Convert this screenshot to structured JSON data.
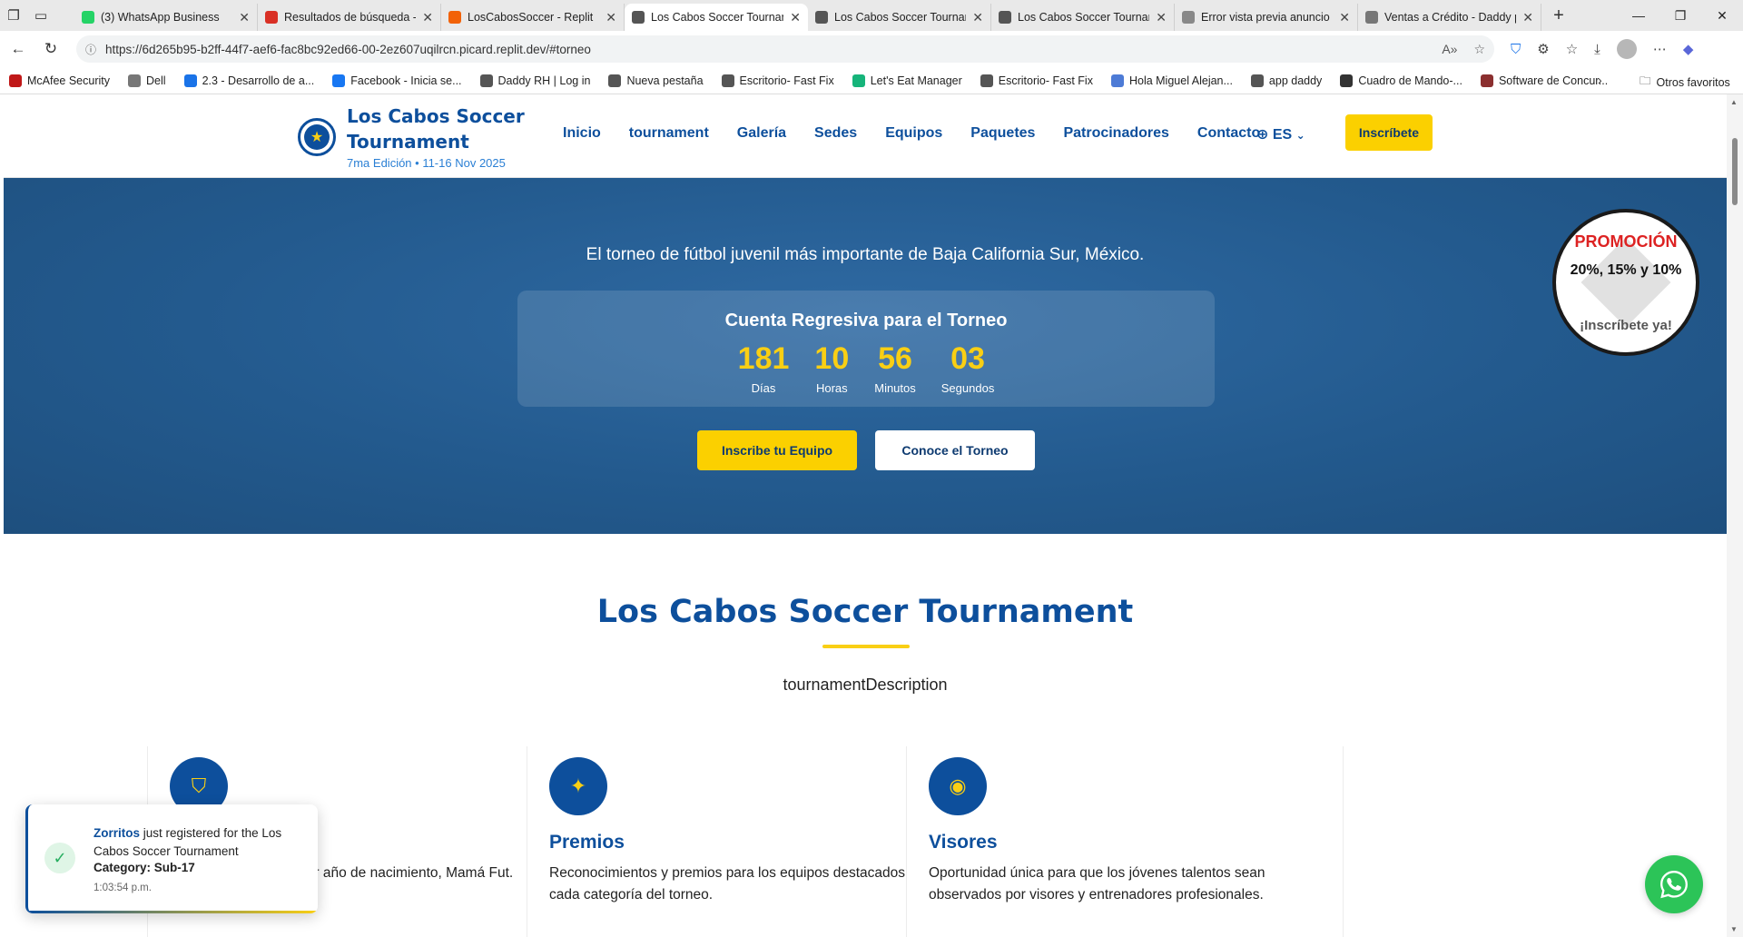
{
  "browser": {
    "tabs": [
      {
        "title": "(3) WhatsApp Business",
        "icon": "whatsapp-icon",
        "color": "#25d366"
      },
      {
        "title": "Resultados de búsqueda -",
        "icon": "gmail-icon",
        "color": "#d93025"
      },
      {
        "title": "LosCabosSoccer - Replit",
        "icon": "replit-icon",
        "color": "#f26207"
      },
      {
        "title": "Los Cabos Soccer Tournam",
        "icon": "globe-icon",
        "color": "#555555",
        "active": true
      },
      {
        "title": "Los Cabos Soccer Tournam",
        "icon": "globe-icon",
        "color": "#555555"
      },
      {
        "title": "Los Cabos Soccer Tournam",
        "icon": "globe-icon",
        "color": "#555555"
      },
      {
        "title": "Error vista previa anuncio",
        "icon": "circle-icon",
        "color": "#888888"
      },
      {
        "title": "Ventas a Crédito - Daddy p",
        "icon": "doc-icon",
        "color": "#777777"
      }
    ],
    "url": "https://6d265b95-b2ff-44f7-aef6-fac8bc92ed66-00-2ez607uqilrcn.picard.replit.dev/#torneo",
    "bookmarks": [
      {
        "label": "McAfee Security",
        "icon": "mcafee-icon",
        "color": "#c01818"
      },
      {
        "label": "Dell",
        "icon": "folder-icon",
        "color": "#777777"
      },
      {
        "label": "2.3 - Desarrollo de a...",
        "icon": "loading-icon",
        "color": "#1a73e8"
      },
      {
        "label": "Facebook - Inicia se...",
        "icon": "facebook-icon",
        "color": "#1877f2"
      },
      {
        "label": "Daddy RH | Log in",
        "icon": "globe-icon",
        "color": "#555555"
      },
      {
        "label": "Nueva pestaña",
        "icon": "globe-icon",
        "color": "#555555"
      },
      {
        "label": "Escritorio- Fast Fix",
        "icon": "globe-icon",
        "color": "#555555"
      },
      {
        "label": "Let's Eat Manager",
        "icon": "app-icon",
        "color": "#16b47a"
      },
      {
        "label": "Escritorio- Fast Fix",
        "icon": "globe-icon",
        "color": "#555555"
      },
      {
        "label": "Hola Miguel Alejan...",
        "icon": "grid-icon",
        "color": "#4d7bd6"
      },
      {
        "label": "app daddy",
        "icon": "globe-icon",
        "color": "#555555"
      },
      {
        "label": "Cuadro de Mando-...",
        "icon": "dashboard-icon",
        "color": "#333333"
      },
      {
        "label": "Software de Concur...",
        "icon": "diamond-icon",
        "color": "#8b2f2f"
      }
    ],
    "other_bookmarks": "Otros favoritos"
  },
  "site": {
    "brand_name": "Los Cabos Soccer Tournament",
    "brand_sub": "7ma Edición • 11-16 Nov 2025",
    "nav": [
      "Inicio",
      "tournament",
      "Galería",
      "Sedes",
      "Equipos",
      "Paquetes",
      "Patrocinadores",
      "Contacto"
    ],
    "lang": "ES",
    "cta": "Inscríbete"
  },
  "hero": {
    "subtitle": "El torneo de fútbol juvenil más importante de Baja California Sur, México.",
    "countdown_title": "Cuenta Regresiva para el Torneo",
    "countdown": [
      {
        "value": "181",
        "label": "Días"
      },
      {
        "value": "10",
        "label": "Horas"
      },
      {
        "value": "56",
        "label": "Minutos"
      },
      {
        "value": "03",
        "label": "Segundos"
      }
    ],
    "btn_primary": "Inscribe tu Equipo",
    "btn_secondary": "Conoce el Torneo"
  },
  "promo": {
    "title": "PROMOCIÓN",
    "discount": "20%, 15% y 10%",
    "cta": "¡Inscríbete ya!"
  },
  "section": {
    "title": "Los Cabos Soccer Tournament",
    "description": "tournamentDescription",
    "cards": [
      {
        "title": "",
        "desc": "múltiples categorías por año de nacimiento, Mamá Fut.",
        "icon": "shield-icon"
      },
      {
        "title": "Premios",
        "desc": "Reconocimientos y premios para los equipos destacados en cada categoría del torneo.",
        "icon": "sparkles-icon"
      },
      {
        "title": "Visores",
        "desc": "Oportunidad única para que los jóvenes talentos sean observados por visores y entrenadores profesionales.",
        "icon": "eye-icon"
      }
    ]
  },
  "toast": {
    "team": "Zorritos",
    "message": " just registered for the Los Cabos Soccer Tournament",
    "category": "Category: Sub-17",
    "time": "1:03:54 p.m."
  },
  "colors": {
    "brand_blue": "#0d4f9c",
    "accent_yellow": "#fbd000",
    "whatsapp_green": "#2cc458"
  }
}
